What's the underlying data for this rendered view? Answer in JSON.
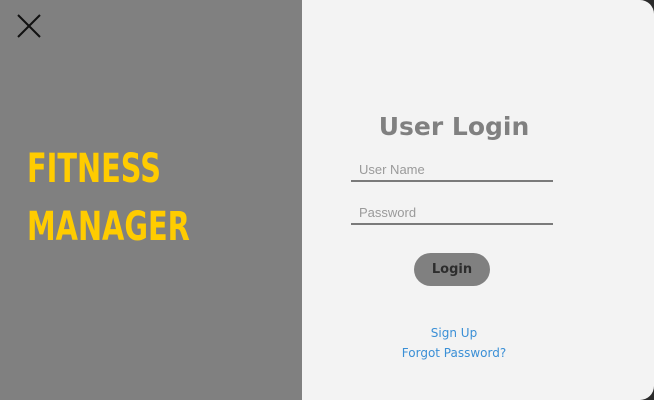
{
  "left_panel": {
    "close_icon": "close-icon",
    "title_line1": "FITNESS",
    "title_line2": "MANAGER",
    "title_color": "#ffcc00",
    "background": "#808080"
  },
  "login": {
    "title": "User Login",
    "username_placeholder": "User Name",
    "username_value": "",
    "password_placeholder": "Password",
    "password_value": "",
    "login_label": "Login",
    "signup_label": "Sign Up",
    "forgot_label": "Forgot Password?",
    "link_color": "#3a8fd6",
    "background": "#f3f3f3"
  }
}
